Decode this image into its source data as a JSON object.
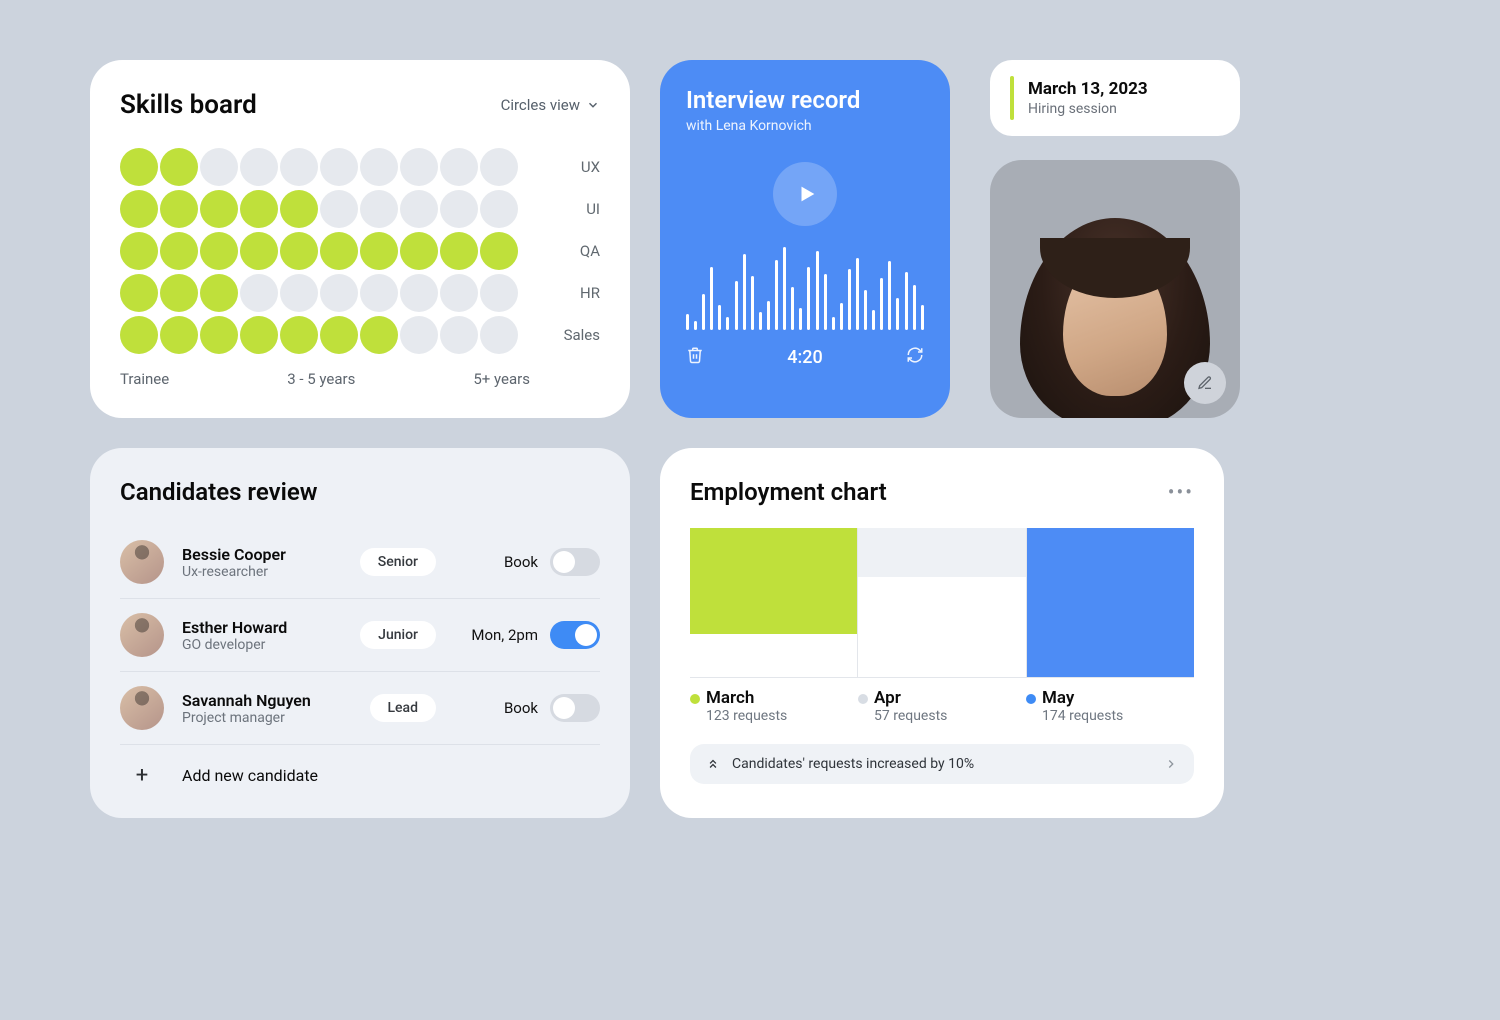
{
  "colors": {
    "accent": "#bfe03b",
    "blue": "#4d8cf5",
    "bluebtn": "#3e8bf5"
  },
  "skills": {
    "title": "Skills board",
    "view_label": "Circles view",
    "rows": [
      {
        "label": "UX",
        "filled": 2
      },
      {
        "label": "UI",
        "filled": 5
      },
      {
        "label": "QA",
        "filled": 10
      },
      {
        "label": "HR",
        "filled": 3
      },
      {
        "label": "Sales",
        "filled": 7
      }
    ],
    "max_dots": 10,
    "xaxis": [
      "Trainee",
      "3 - 5 years",
      "5+ years"
    ]
  },
  "interview": {
    "title": "Interview record",
    "subtitle": "with Lena Kornovich",
    "time": "4:20",
    "waveform": [
      18,
      10,
      40,
      70,
      28,
      14,
      55,
      85,
      60,
      20,
      32,
      78,
      92,
      48,
      24,
      70,
      88,
      62,
      15,
      30,
      68,
      80,
      45,
      22,
      58,
      77,
      36,
      65,
      50,
      28
    ]
  },
  "date_chip": {
    "date": "March 13, 2023",
    "label": "Hiring session"
  },
  "review": {
    "title": "Candidates review",
    "add_label": "Add new candidate",
    "rows": [
      {
        "name": "Bessie Cooper",
        "role": "Ux-researcher",
        "level": "Senior",
        "book_label": "Book",
        "booked": false
      },
      {
        "name": "Esther Howard",
        "role": "GO developer",
        "level": "Junior",
        "book_label": "Mon, 2pm",
        "booked": true
      },
      {
        "name": "Savannah Nguyen",
        "role": "Project manager",
        "level": "Lead",
        "book_label": "Book",
        "booked": false
      }
    ]
  },
  "chart_data": {
    "type": "bar",
    "title": "Employment chart",
    "categories": [
      "March",
      "Apr",
      "May"
    ],
    "series": [
      {
        "name": "requests",
        "values": [
          123,
          57,
          174
        ]
      }
    ],
    "value_label_suffix": " requests",
    "colors": [
      "#bfe03b",
      "#eef1f5",
      "#4d8cf5"
    ],
    "banner": "Candidates' requests increased by 10%"
  }
}
